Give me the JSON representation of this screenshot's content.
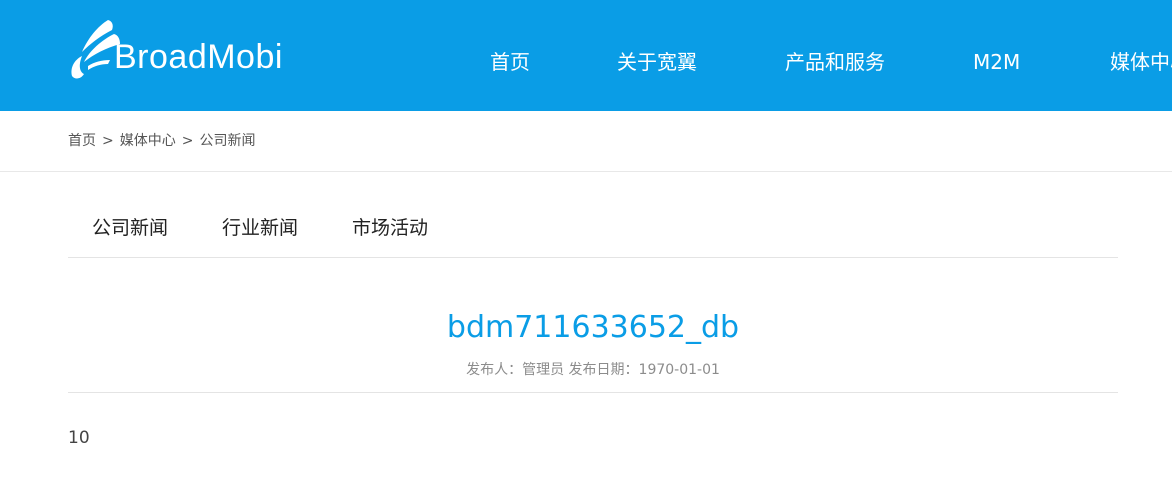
{
  "header": {
    "logo_text": "BroadMobi",
    "nav": [
      {
        "label": "首页"
      },
      {
        "label": "关于宽翼"
      },
      {
        "label": "产品和服务"
      },
      {
        "label": "M2M"
      },
      {
        "label": "媒体中心"
      }
    ],
    "background_color": "#0a9de6"
  },
  "breadcrumb": {
    "items": [
      "首页",
      "媒体中心",
      "公司新闻"
    ],
    "separator": ">"
  },
  "subnav": {
    "tabs": [
      {
        "label": "公司新闻"
      },
      {
        "label": "行业新闻"
      },
      {
        "label": "市场活动"
      }
    ]
  },
  "article": {
    "title": "bdm711633652_db",
    "meta": "发布人：管理员 发布日期：1970-01-01",
    "body": "10",
    "title_color": "#0a9de6"
  },
  "icons": {
    "logo": "wing-logo-icon"
  }
}
